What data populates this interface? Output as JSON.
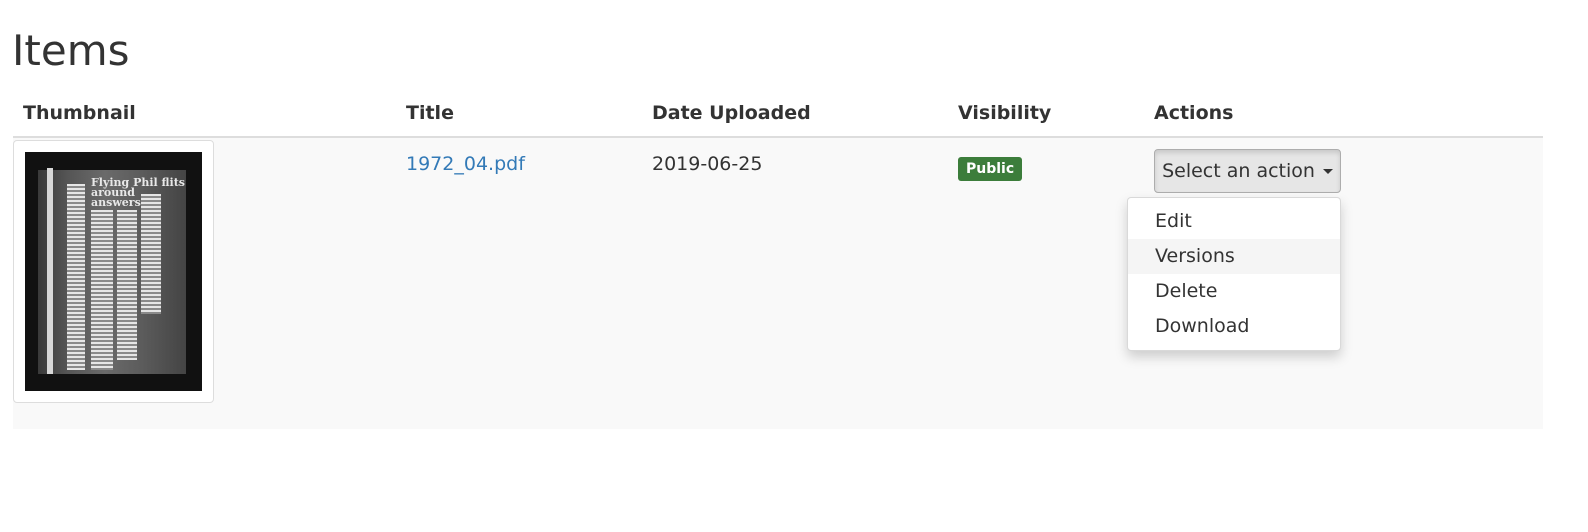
{
  "page": {
    "title": "Items"
  },
  "table": {
    "columns": [
      "Thumbnail",
      "Title",
      "Date Uploaded",
      "Visibility",
      "Actions"
    ],
    "rows": [
      {
        "thumbnail_icon": "document-scan-thumbnail",
        "thumbnail_headline": "Flying Phil flits\naround\nanswers",
        "title": "1972_04.pdf",
        "date_uploaded": "2019-06-25",
        "visibility": "Public",
        "action_button_label": "Select an action"
      }
    ]
  },
  "actions_menu": {
    "items": [
      "Edit",
      "Versions",
      "Delete",
      "Download"
    ],
    "highlighted": "Versions"
  },
  "colors": {
    "link": "#337ab7",
    "badge_public": "#3c7d3b",
    "row_background": "#f9f9f9",
    "menu_highlight": "#f5f5f5"
  }
}
